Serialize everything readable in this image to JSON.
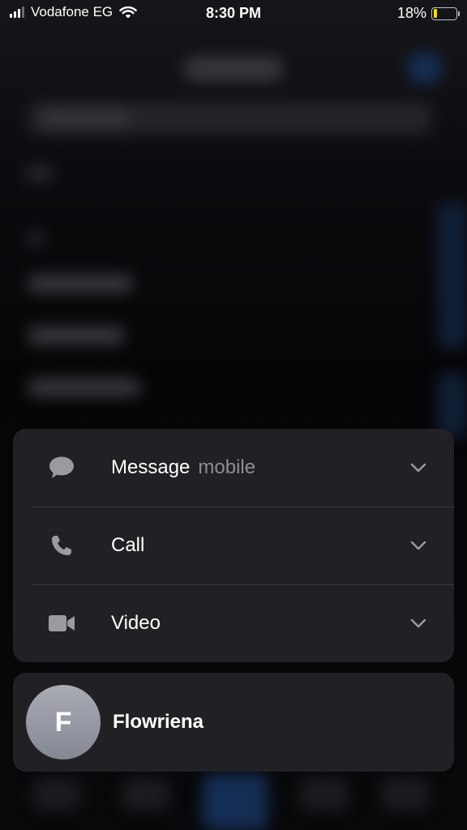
{
  "status_bar": {
    "carrier": "Vodafone EG",
    "time": "8:30 PM",
    "battery_percent": "18%",
    "battery_level": 0.18,
    "battery_color": "#f5d90a",
    "signal_bars_filled": 3,
    "signal_bars_total": 4
  },
  "menu": {
    "items": [
      {
        "label": "Message",
        "sublabel": "mobile",
        "icon": "message-bubble-icon"
      },
      {
        "label": "Call",
        "sublabel": "",
        "icon": "phone-icon"
      },
      {
        "label": "Video",
        "sublabel": "",
        "icon": "video-camera-icon"
      }
    ]
  },
  "contact": {
    "initial": "F",
    "name": "Flowriena"
  }
}
